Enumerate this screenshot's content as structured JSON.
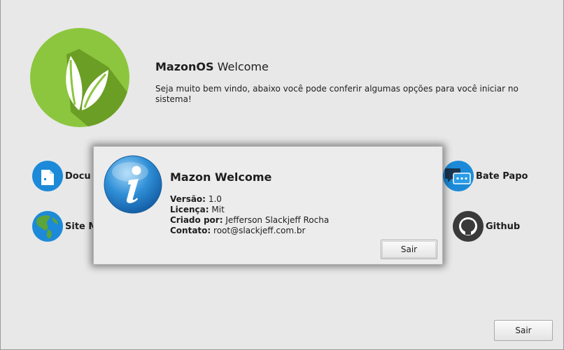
{
  "colors": {
    "background": "#e8e8e8",
    "logo_green": "#8cc63e",
    "link_blue": "#1c8ad8",
    "info_blue": "#1e7fcb"
  },
  "header": {
    "title_bold": "MazonOS",
    "title_regular": "Welcome",
    "subtitle": "Seja muito bem vindo, abaixo você pode conferir algumas opções para você iniciar no sistema!"
  },
  "links": {
    "docs": {
      "label": "Docu",
      "icon": "document-icon"
    },
    "site": {
      "label": "Site M",
      "icon": "globe-icon"
    },
    "chat": {
      "label": "Bate Papo",
      "icon": "chat-icon"
    },
    "github": {
      "label": "Github",
      "icon": "github-icon"
    }
  },
  "main_exit_label": "Sair",
  "dialog": {
    "title": "Mazon Welcome",
    "icon": "info-icon",
    "rows": [
      {
        "label": "Versão:",
        "value": "1.0"
      },
      {
        "label": "Licença:",
        "value": "Mit"
      },
      {
        "label": "Criado por:",
        "value": "Jefferson Slackjeff Rocha"
      },
      {
        "label": "Contato:",
        "value": "root@slackjeff.com.br"
      }
    ],
    "exit_label": "Sair"
  }
}
